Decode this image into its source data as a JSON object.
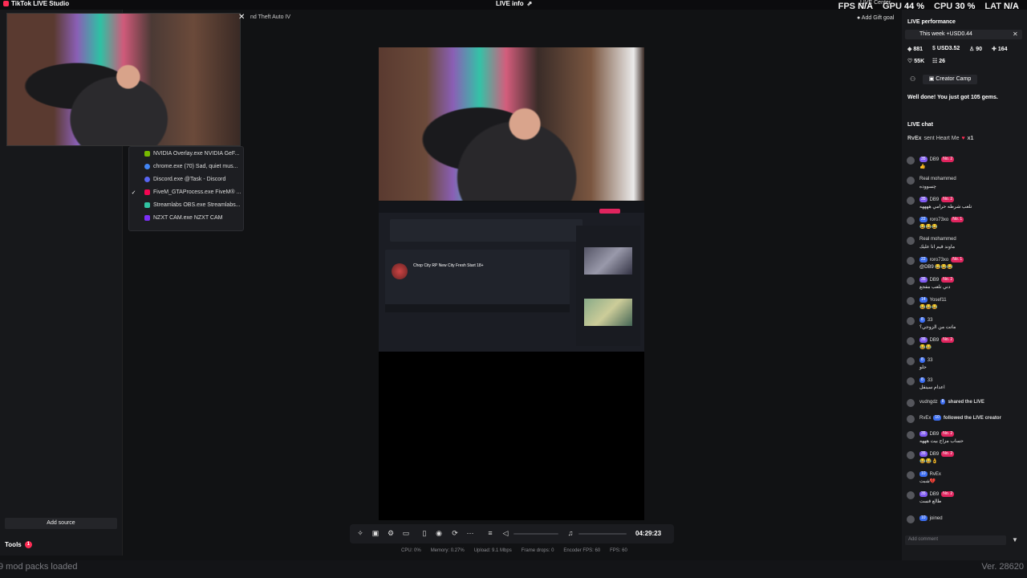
{
  "window": {
    "app_title": "TikTok LIVE Studio",
    "live_info": "LIVE info",
    "live_center": "LIVE Center",
    "gift_goal": "Add Gift goal"
  },
  "overlay_stats": {
    "fps_label": "FPS",
    "fps_value": "N/A",
    "gpu_label": "GPU",
    "gpu_value": "44 %",
    "cpu_label": "CPU",
    "cpu_value": "30 %",
    "lat_label": "LAT",
    "lat_value": "N/A"
  },
  "sources": {
    "game_tab": "nd Theft Auto IV",
    "menu": [
      {
        "label": "NVIDIA Overlay.exe NVIDIA GeF...",
        "checked": false,
        "color": "#76b900"
      },
      {
        "label": "chrome.exe (70) Sad, quiet mus...",
        "checked": false,
        "color": "#4285f4"
      },
      {
        "label": "Discord.exe @Task - Discord",
        "checked": false,
        "color": "#5865f2"
      },
      {
        "label": "FiveM_GTAProcess.exe FiveM® ...",
        "checked": true,
        "color": "#f40552"
      },
      {
        "label": "Streamlabs OBS.exe Streamlabs...",
        "checked": false,
        "color": "#31c3a2"
      },
      {
        "label": "NZXT CAM.exe NZXT CAM",
        "checked": false,
        "color": "#7b2ff7"
      }
    ],
    "add_source": "Add source",
    "tools_label": "Tools",
    "tools_badge": "1"
  },
  "preview": {
    "game_title": "Chop City RP New City Fresh Start 18+"
  },
  "toolbar": {
    "timer": "04:29:23",
    "stats": {
      "cpu": "CPU: 0%",
      "memory": "Memory: 0.27%",
      "upload": "Upload: 9.1 Mbps",
      "frame_drops": "Frame drops: 0",
      "encoder_fps": "Encoder FPS: 60",
      "fps": "FPS: 60"
    }
  },
  "footer": {
    "left": "9 mod packs loaded",
    "right": "Ver. 28620"
  },
  "performance": {
    "title": "LIVE performance",
    "week": "This week +USD0.44",
    "metrics": [
      {
        "icon": "◆",
        "value": "881"
      },
      {
        "icon": "$",
        "value": "USD3.52"
      },
      {
        "icon": "♙",
        "value": "90"
      },
      {
        "icon": "✚",
        "value": "164"
      },
      {
        "icon": "♡",
        "value": "55K"
      },
      {
        "icon": "☷",
        "value": "26"
      }
    ],
    "creator_camp": "Creator Camp",
    "gems_note": "Well done! You just got 105 gems."
  },
  "chat": {
    "title": "LIVE chat",
    "gift_user": "RvEx",
    "gift_text": "sent Heart Me",
    "gift_count": "x1",
    "messages": [
      {
        "level": "35",
        "name": "DB9",
        "rank": "No. 2",
        "text": "👍"
      },
      {
        "level": "",
        "name": "Real mohammed",
        "rank": "",
        "text": "چسووده"
      },
      {
        "level": "35",
        "name": "DB9",
        "rank": "No. 2",
        "text": "تلعب شرطه حرامي ههههه"
      },
      {
        "level": "22",
        "name": "roro73xo",
        "rank": "No. 1",
        "text": "😂😂😂"
      },
      {
        "level": "",
        "name": "Real mohammed",
        "rank": "",
        "text": "ماوند قيم انا عليك"
      },
      {
        "level": "22",
        "name": "roro73xo",
        "rank": "No. 1",
        "text": "@DB9 😂😂😂"
      },
      {
        "level": "35",
        "name": "DB9",
        "rank": "No. 2",
        "text": "دني تلعب مفجع"
      },
      {
        "level": "14",
        "name": "Yosef11",
        "rank": "",
        "text": "😂😂😂"
      },
      {
        "level": "8",
        "name": "33",
        "rank": "",
        "text": "ماتت من الزوجي؟"
      },
      {
        "level": "35",
        "name": "DB9",
        "rank": "No. 2",
        "text": "😂😂"
      },
      {
        "level": "8",
        "name": "33",
        "rank": "",
        "text": "حلو"
      },
      {
        "level": "8",
        "name": "33",
        "rank": "",
        "text": "اعدام سينقل"
      },
      {
        "level": "8",
        "name": "vudngdz",
        "rank": "",
        "text": "shared the LIVE"
      },
      {
        "level": "10",
        "name": "RvEx",
        "rank": "",
        "text": "followed the LIVE creator"
      },
      {
        "level": "35",
        "name": "DB9",
        "rank": "No. 2",
        "text": "حساب مزاج بيت هههه"
      },
      {
        "level": "35",
        "name": "DB9",
        "rank": "No. 2",
        "text": "😂😂👌"
      },
      {
        "level": "10",
        "name": "RvEx",
        "rank": "",
        "text": "شبت💔"
      },
      {
        "level": "35",
        "name": "DB9",
        "rank": "No. 2",
        "text": "طالع قست"
      },
      {
        "level": "10",
        "name": "",
        "rank": "",
        "text": "joined"
      }
    ],
    "comment_placeholder": "Add comment"
  }
}
